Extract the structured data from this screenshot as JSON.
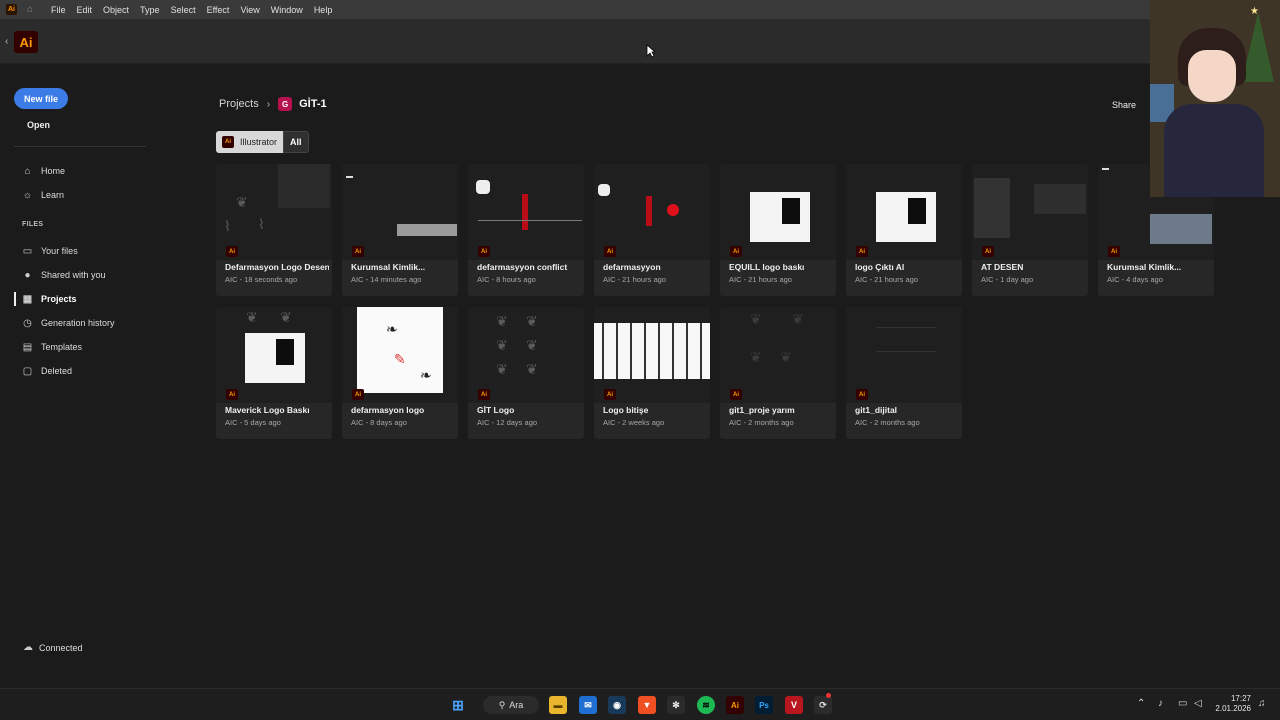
{
  "menubar": {
    "items": [
      "File",
      "Edit",
      "Object",
      "Type",
      "Select",
      "Effect",
      "View",
      "Window",
      "Help"
    ]
  },
  "app": {
    "logo_text": "Ai"
  },
  "sidebar": {
    "new_file": "New file",
    "open": "Open",
    "nav_top": [
      {
        "label": "Home",
        "icon": "home-icon"
      },
      {
        "label": "Learn",
        "icon": "bulb-icon"
      }
    ],
    "files_heading": "FILES",
    "nav_files": [
      {
        "label": "Your files",
        "icon": "file-icon"
      },
      {
        "label": "Shared with you",
        "icon": "person-icon"
      },
      {
        "label": "Projects",
        "icon": "projects-icon",
        "active": true
      },
      {
        "label": "Generation history",
        "icon": "history-icon"
      },
      {
        "label": "Templates",
        "icon": "template-icon"
      },
      {
        "label": "Deleted",
        "icon": "trash-icon"
      }
    ],
    "status": "Connected"
  },
  "breadcrumb": {
    "root": "Projects",
    "project_initial": "G",
    "project": "GİT-1"
  },
  "share": "Share",
  "filters": {
    "illustrator": "Illustrator",
    "all": "All",
    "badge": "Ai"
  },
  "files_row1": [
    {
      "name": "Defarmasyon Logo Desen",
      "meta": "AIC - 18 seconds ago"
    },
    {
      "name": "Kurumsal Kimlik...",
      "meta": "AIC - 14 minutes ago"
    },
    {
      "name": "defarmasyyon conflict",
      "meta": "AIC - 8 hours ago"
    },
    {
      "name": "defarmasyyon",
      "meta": "AIC - 21 hours ago"
    },
    {
      "name": "EQUILL logo baskı",
      "meta": "AIC - 21 hours ago"
    },
    {
      "name": "logo Çıktı Al",
      "meta": "AIC - 21 hours ago"
    },
    {
      "name": "AT DESEN",
      "meta": "AIC - 1 day ago"
    },
    {
      "name": "Kurumsal Kimlik...",
      "meta": "AIC - 4 days ago"
    }
  ],
  "files_row2": [
    {
      "name": "Maverick Logo Baskı",
      "meta": "AIC - 5 days ago"
    },
    {
      "name": "defarmasyon logo",
      "meta": "AIC - 8 days ago"
    },
    {
      "name": "GİT Logo",
      "meta": "AIC - 12 days ago"
    },
    {
      "name": "Logo bitişe",
      "meta": "AIC - 2 weeks ago"
    },
    {
      "name": "git1_proje yarım",
      "meta": "AIC - 2 months ago"
    },
    {
      "name": "git1_dijital",
      "meta": "AIC - 2 months ago"
    }
  ],
  "taskbar": {
    "search": "Ara",
    "time": "17:27",
    "date": "2.01.2026"
  },
  "colors": {
    "accent": "#3b7ce6",
    "ai_orange": "#ff9a00",
    "project_badge": "#b5124f"
  }
}
